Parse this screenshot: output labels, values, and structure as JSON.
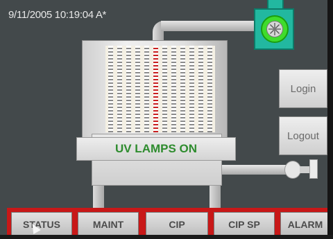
{
  "timestamp": "9/11/2005 10:19:04 A*",
  "process": {
    "status_text": "UV LAMPS ON",
    "status_color": "#2e8c2e",
    "fan_color": "#22b8a0",
    "fan_ring_color": "#3fdc2c",
    "lamp_count": 12,
    "highlighted_lamp": 5
  },
  "side_buttons": {
    "login": "Login",
    "logout": "Logout"
  },
  "nav": {
    "strip_color": "#c81818",
    "items": [
      {
        "label": "STATUS"
      },
      {
        "label": "MAINT"
      },
      {
        "label": "CIP"
      },
      {
        "label": "CIP SP"
      },
      {
        "label": "ALARM"
      }
    ]
  },
  "icons": [
    "fan-icon",
    "valve-icon",
    "cursor-icon"
  ]
}
